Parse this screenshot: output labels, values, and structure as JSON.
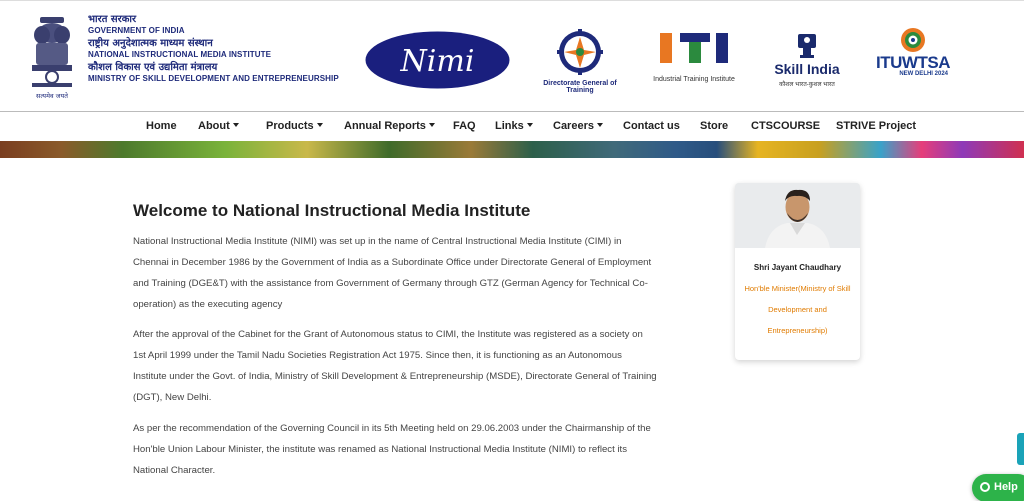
{
  "header": {
    "gov_hindi": "भारत सरकार",
    "gov_english": "GOVERNMENT OF INDIA",
    "nimi_hindi": "राष्ट्रीय अनुदेशात्मक माध्यम संस्थान",
    "nimi_english": "NATIONAL INSTRUCTIONAL MEDIA INSTITUTE",
    "ministry_hindi": "कौशल विकास एवं उद्यमिता मंत्रालय",
    "ministry_english": "MINISTRY OF SKILL DEVELOPMENT AND ENTREPRENEURSHIP",
    "emblem_motto": "सत्यमेव जयते",
    "nimi_logo_text": "Nimi",
    "dgt_caption": "Directorate General of Training",
    "iti_caption": "Industrial Training Institute",
    "skill_india_title": "Skill India",
    "skill_india_sub": "कौशल भारत-कुशल भारत",
    "itu_title_a": "ITU",
    "itu_title_b": "WTSA",
    "itu_sub": "NEW DELHI 2024"
  },
  "nav": {
    "items": [
      {
        "label": "Home"
      },
      {
        "label": "About"
      },
      {
        "label": "Products"
      },
      {
        "label": "Annual Reports"
      },
      {
        "label": "FAQ"
      },
      {
        "label": "Links"
      },
      {
        "label": "Careers"
      },
      {
        "label": "Contact us"
      },
      {
        "label": "Store"
      },
      {
        "label": "CTSCOURSE"
      },
      {
        "label": "STRIVE Project"
      }
    ]
  },
  "main": {
    "title": "Welcome to National Instructional Media Institute",
    "paragraphs": [
      "National Instructional Media Institute (NIMI) was set up in the name of Central Instructional Media Institute (CIMI) in Chennai in December 1986 by the Government of India as a Subordinate Office under Directorate General of Employment and Training (DGE&T) with the assistance from Government of Germany through GTZ (German Agency for Technical Co-operation) as the executing agency",
      "After the approval of the Cabinet for the Grant of Autonomous status to CIMI, the Institute was registered as a society on 1st April 1999 under the Tamil Nadu Societies Registration Act 1975. Since then, it is functioning as an Autonomous Institute under the Govt. of India, Ministry of Skill Development & Entrepreneurship (MSDE), Directorate General of Training (DGT), New Delhi.",
      "As per the recommendation of the Governing Council in its 5th Meeting held on 29.06.2003 under the Chairmanship of the Hon'ble Union Labour Minister, the institute was renamed as National Instructional Media Institute (NIMI) to reflect its National Character."
    ]
  },
  "minister": {
    "name": "Shri Jayant Chaudhary",
    "role": "Hon'ble Minister(Ministry of Skill Development and Entrepreneurship)"
  },
  "help": {
    "label": "Help"
  },
  "colors": {
    "brand_blue": "#1e2a7a",
    "accent_orange": "#e07b00",
    "help_green": "#2db34a"
  }
}
